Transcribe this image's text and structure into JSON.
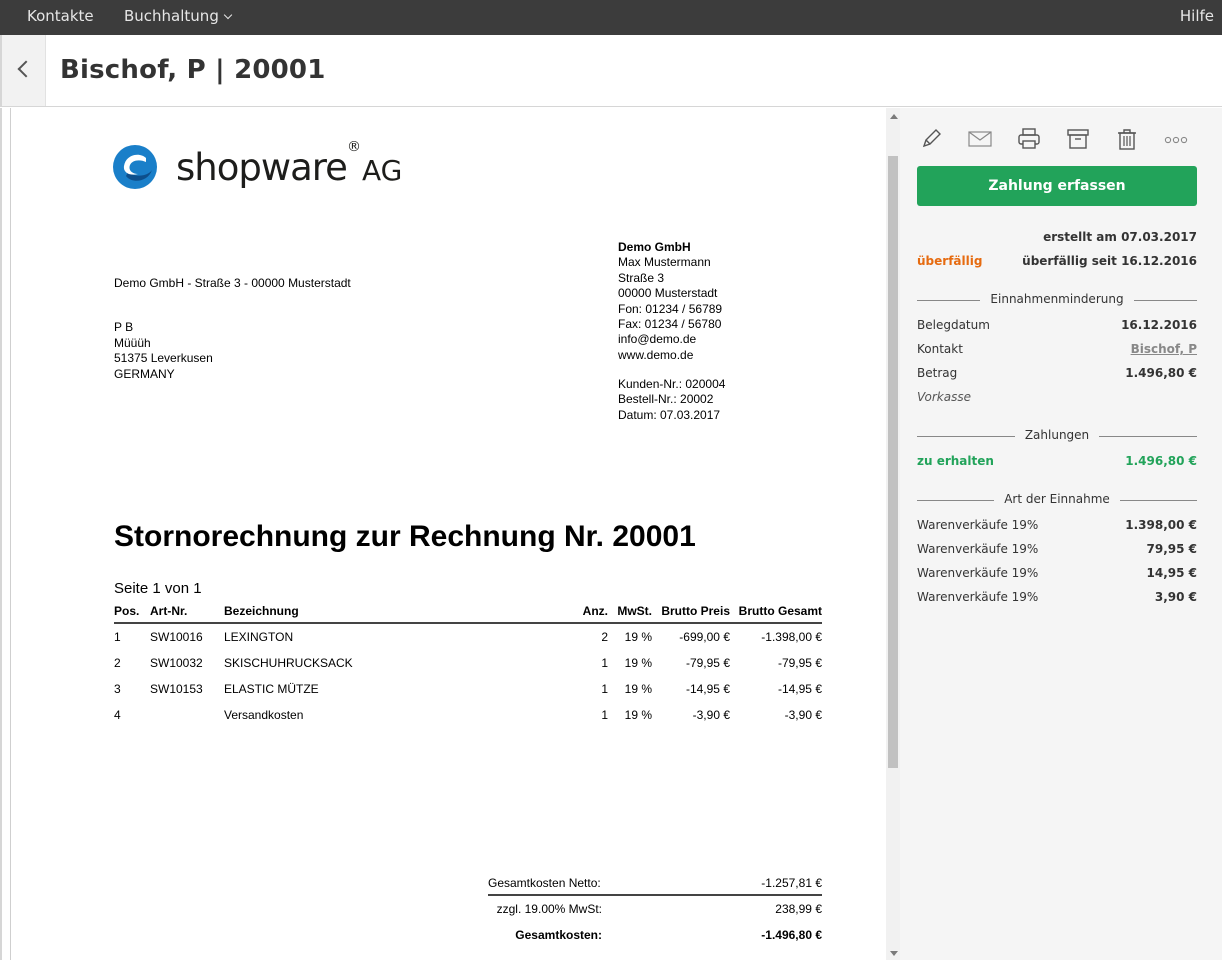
{
  "nav": {
    "contacts": "Kontakte",
    "accounting": "Buchhaltung",
    "help": "Hilfe"
  },
  "header": {
    "title": "Bischof, P | 20001"
  },
  "document": {
    "logo": {
      "word": "shopware",
      "mark": "®",
      "suffix": "AG"
    },
    "sender_line": "Demo GmbH - Straße 3 - 00000 Musterstadt",
    "recipient": [
      "P B",
      "Müüüh",
      "51375 Leverkusen",
      "GERMANY"
    ],
    "company": {
      "name": "Demo GmbH",
      "lines": [
        "Max Mustermann",
        "Straße 3",
        "00000 Musterstadt",
        "Fon: 01234 / 56789",
        "Fax: 01234 / 56780",
        "info@demo.de",
        "www.demo.de"
      ]
    },
    "ids": [
      "Kunden-Nr.: 020004",
      "Bestell-Nr.: 20002",
      "Datum: 07.03.2017"
    ],
    "title": "Stornorechnung zur Rechnung Nr. 20001",
    "page_of": "Seite 1 von 1",
    "columns": {
      "pos": "Pos.",
      "art": "Art-Nr.",
      "bez": "Bezeichnung",
      "anz": "Anz.",
      "mwst": "MwSt.",
      "preis": "Brutto Preis",
      "gesamt": "Brutto Gesamt"
    },
    "items": [
      {
        "pos": "1",
        "art": "SW10016",
        "bez": "LEXINGTON",
        "anz": "2",
        "mwst": "19 %",
        "preis": "-699,00 €",
        "gesamt": "-1.398,00 €"
      },
      {
        "pos": "2",
        "art": "SW10032",
        "bez": "SKISCHUHRUCKSACK",
        "anz": "1",
        "mwst": "19 %",
        "preis": "-79,95 €",
        "gesamt": "-79,95 €"
      },
      {
        "pos": "3",
        "art": "SW10153",
        "bez": "ELASTIC MÜTZE",
        "anz": "1",
        "mwst": "19 %",
        "preis": "-14,95 €",
        "gesamt": "-14,95 €"
      },
      {
        "pos": "4",
        "art": "",
        "bez": "Versandkosten",
        "anz": "1",
        "mwst": "19 %",
        "preis": "-3,90 €",
        "gesamt": "-3,90 €"
      }
    ],
    "totals": [
      {
        "label": "Gesamtkosten Netto:",
        "value": "-1.257,81 €"
      },
      {
        "label": "zzgl. 19.00% MwSt:",
        "value": "238,99 €"
      },
      {
        "label": "Gesamtkosten:",
        "value": "-1.496,80 €"
      }
    ]
  },
  "sidebar": {
    "tools": [
      "pencil-icon",
      "envelope-icon",
      "printer-icon",
      "archive-icon",
      "trash-icon",
      "more-icon"
    ],
    "pay_button": "Zahlung erfassen",
    "created": "erstellt am 07.03.2017",
    "status": "überfällig",
    "overdue_since": "überfällig seit 16.12.2016",
    "section_reduction": "Einnahmenminderung",
    "fields": {
      "date_label": "Belegdatum",
      "date_value": "16.12.2016",
      "contact_label": "Kontakt",
      "contact_value": "Bischof, P",
      "amount_label": "Betrag",
      "amount_value": "1.496,80 €",
      "payment_method": "Vorkasse"
    },
    "section_payments": "Zahlungen",
    "receivable_label": "zu erhalten",
    "receivable_value": "1.496,80 €",
    "section_revenue_type": "Art der Einnahme",
    "revenue": [
      {
        "label": "Warenverkäufe 19%",
        "value": "1.398,00 €"
      },
      {
        "label": "Warenverkäufe 19%",
        "value": "79,95 €"
      },
      {
        "label": "Warenverkäufe 19%",
        "value": "14,95 €"
      },
      {
        "label": "Warenverkäufe 19%",
        "value": "3,90 €"
      }
    ],
    "colors": {
      "accent_green": "#22a35a",
      "overdue_orange": "#e66b10"
    }
  }
}
